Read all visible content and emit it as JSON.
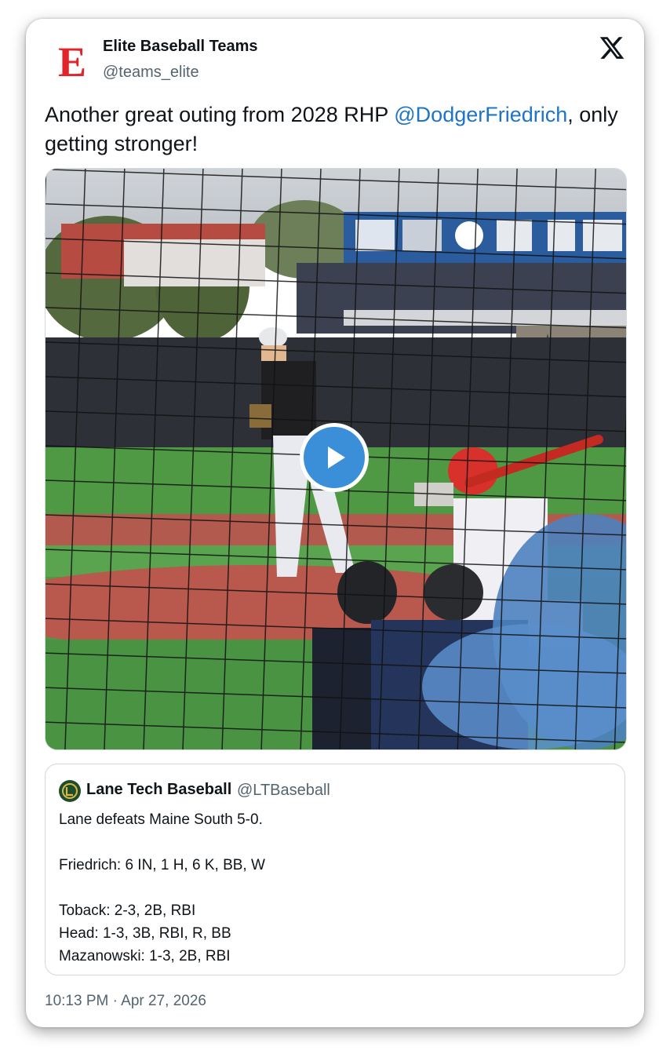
{
  "author": {
    "logo_letter": "E",
    "name": "Elite Baseball Teams",
    "handle": "@teams_elite"
  },
  "platform_icon": "x-logo-icon",
  "tweet": {
    "text_before": "Another great outing from 2028 RHP ",
    "mention": "@DodgerFriedrich",
    "text_after": ", only getting stronger!"
  },
  "media": {
    "type": "video",
    "play_icon": "play-icon"
  },
  "quoted_tweet": {
    "name": "Lane Tech Baseball",
    "handle": "@LTBaseball",
    "lines": [
      "Lane defeats Maine South 5-0.",
      "",
      "Friedrich: 6 IN, 1 H, 6 K, BB, W",
      "",
      "Toback: 2-3, 2B, RBI",
      "Head: 1-3, 3B, RBI, R, BB",
      "Mazanowski: 1-3, 2B, RBI"
    ]
  },
  "timestamp": "10:13 PM · Apr 27, 2026",
  "colors": {
    "mention": "#1d74c9",
    "logo_red": "#e0262b",
    "play_button": "#3b8fd8",
    "secondary_text": "#536471"
  }
}
